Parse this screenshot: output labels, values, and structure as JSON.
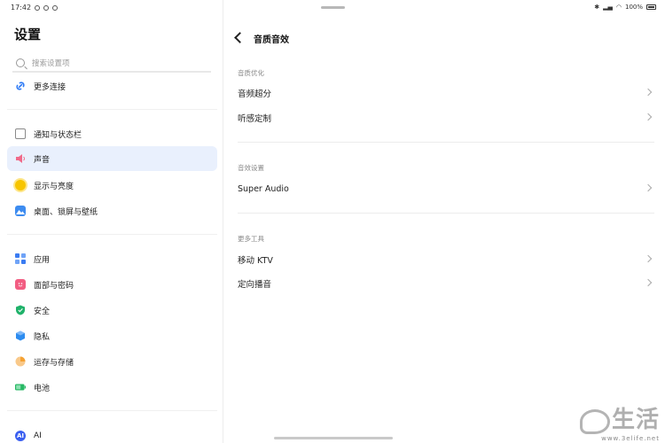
{
  "status": {
    "time": "17:42",
    "right_text": "100%"
  },
  "left": {
    "title": "设置",
    "search_placeholder": "搜索设置项",
    "items": [
      {
        "label": "更多连接",
        "icon": "link-icon",
        "color": "#2f7bf5"
      },
      {
        "label": "通知与状态栏",
        "icon": "notification-icon",
        "color": "#8a8a8a"
      },
      {
        "label": "声音",
        "icon": "speaker-icon",
        "color": "#f06a8a"
      },
      {
        "label": "显示与亮度",
        "icon": "brightness-icon",
        "color": "#f7c500"
      },
      {
        "label": "桌面、锁屏与壁纸",
        "icon": "wallpaper-icon",
        "color": "#3d8cf0"
      },
      {
        "label": "应用",
        "icon": "apps-icon",
        "color": "#3b7cf2"
      },
      {
        "label": "面部与密码",
        "icon": "face-icon",
        "color": "#f25d82"
      },
      {
        "label": "安全",
        "icon": "shield-icon",
        "color": "#1fb26a"
      },
      {
        "label": "隐私",
        "icon": "privacy-icon",
        "color": "#2d8cf0"
      },
      {
        "label": "运存与存储",
        "icon": "storage-icon",
        "color": "#f5a234"
      },
      {
        "label": "电池",
        "icon": "battery-icon",
        "color": "#27b864"
      },
      {
        "label": "AI",
        "icon": "ai-icon",
        "color": "#3a5ff0"
      }
    ]
  },
  "right": {
    "title": "音质音效",
    "sections": [
      {
        "label": "音质优化",
        "rows": [
          "音频超分",
          "听感定制"
        ]
      },
      {
        "label": "音效设置",
        "rows": [
          "Super Audio"
        ]
      },
      {
        "label": "更多工具",
        "rows": [
          "移动 KTV",
          "定向播音"
        ]
      }
    ]
  },
  "watermark": {
    "text": "生活",
    "url": "www.3elife.net"
  }
}
